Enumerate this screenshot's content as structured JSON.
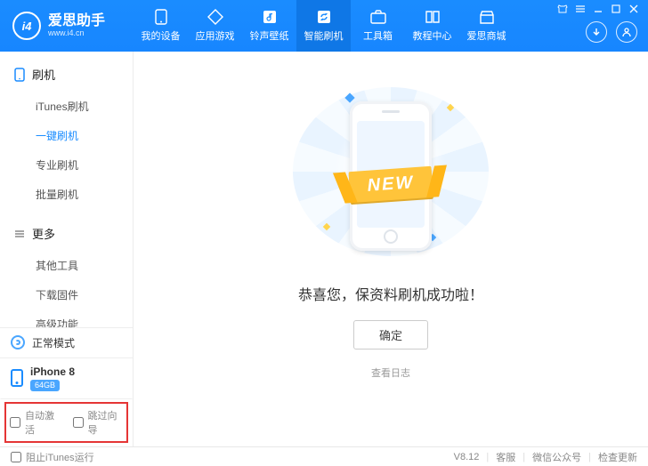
{
  "brand": {
    "cn": "爱思助手",
    "en": "www.i4.cn",
    "logo_letters": "i4"
  },
  "window_controls": {
    "shirt": "shirt",
    "menu": "menu",
    "min": "min",
    "max": "max",
    "close": "close"
  },
  "header_circles": {
    "download": "download",
    "user": "user"
  },
  "nav": [
    {
      "id": "devices",
      "label": "我的设备",
      "icon": "phone"
    },
    {
      "id": "apps",
      "label": "应用游戏",
      "icon": "apps"
    },
    {
      "id": "ringtone",
      "label": "铃声壁纸",
      "icon": "note"
    },
    {
      "id": "flash",
      "label": "智能刷机",
      "icon": "refresh",
      "active": true
    },
    {
      "id": "toolbox",
      "label": "工具箱",
      "icon": "briefcase"
    },
    {
      "id": "tutorial",
      "label": "教程中心",
      "icon": "book"
    },
    {
      "id": "store",
      "label": "爱思商城",
      "icon": "store"
    }
  ],
  "sidebar": {
    "groups": [
      {
        "id": "flash",
        "title": "刷机",
        "icon": "phone",
        "items": [
          {
            "id": "itunes",
            "label": "iTunes刷机"
          },
          {
            "id": "oneclick",
            "label": "一键刷机",
            "active": true
          },
          {
            "id": "pro",
            "label": "专业刷机"
          },
          {
            "id": "batch",
            "label": "批量刷机"
          }
        ]
      },
      {
        "id": "more",
        "title": "更多",
        "icon": "menu",
        "items": [
          {
            "id": "other",
            "label": "其他工具"
          },
          {
            "id": "download",
            "label": "下载固件"
          },
          {
            "id": "advanced",
            "label": "高级功能"
          }
        ]
      }
    ],
    "mode": {
      "label": "正常模式"
    },
    "device": {
      "name": "iPhone 8",
      "capacity": "64GB"
    },
    "bottom_options": {
      "auto_activate": "自动激活",
      "skip_wizard": "跳过向导"
    }
  },
  "main": {
    "ribbon": "NEW",
    "success_text": "恭喜您，保资料刷机成功啦！",
    "ok_button": "确定",
    "view_log": "查看日志"
  },
  "footer": {
    "block_itunes": "阻止iTunes运行",
    "version": "V8.12",
    "links": {
      "support": "客服",
      "wechat": "微信公众号",
      "update": "检查更新"
    }
  }
}
